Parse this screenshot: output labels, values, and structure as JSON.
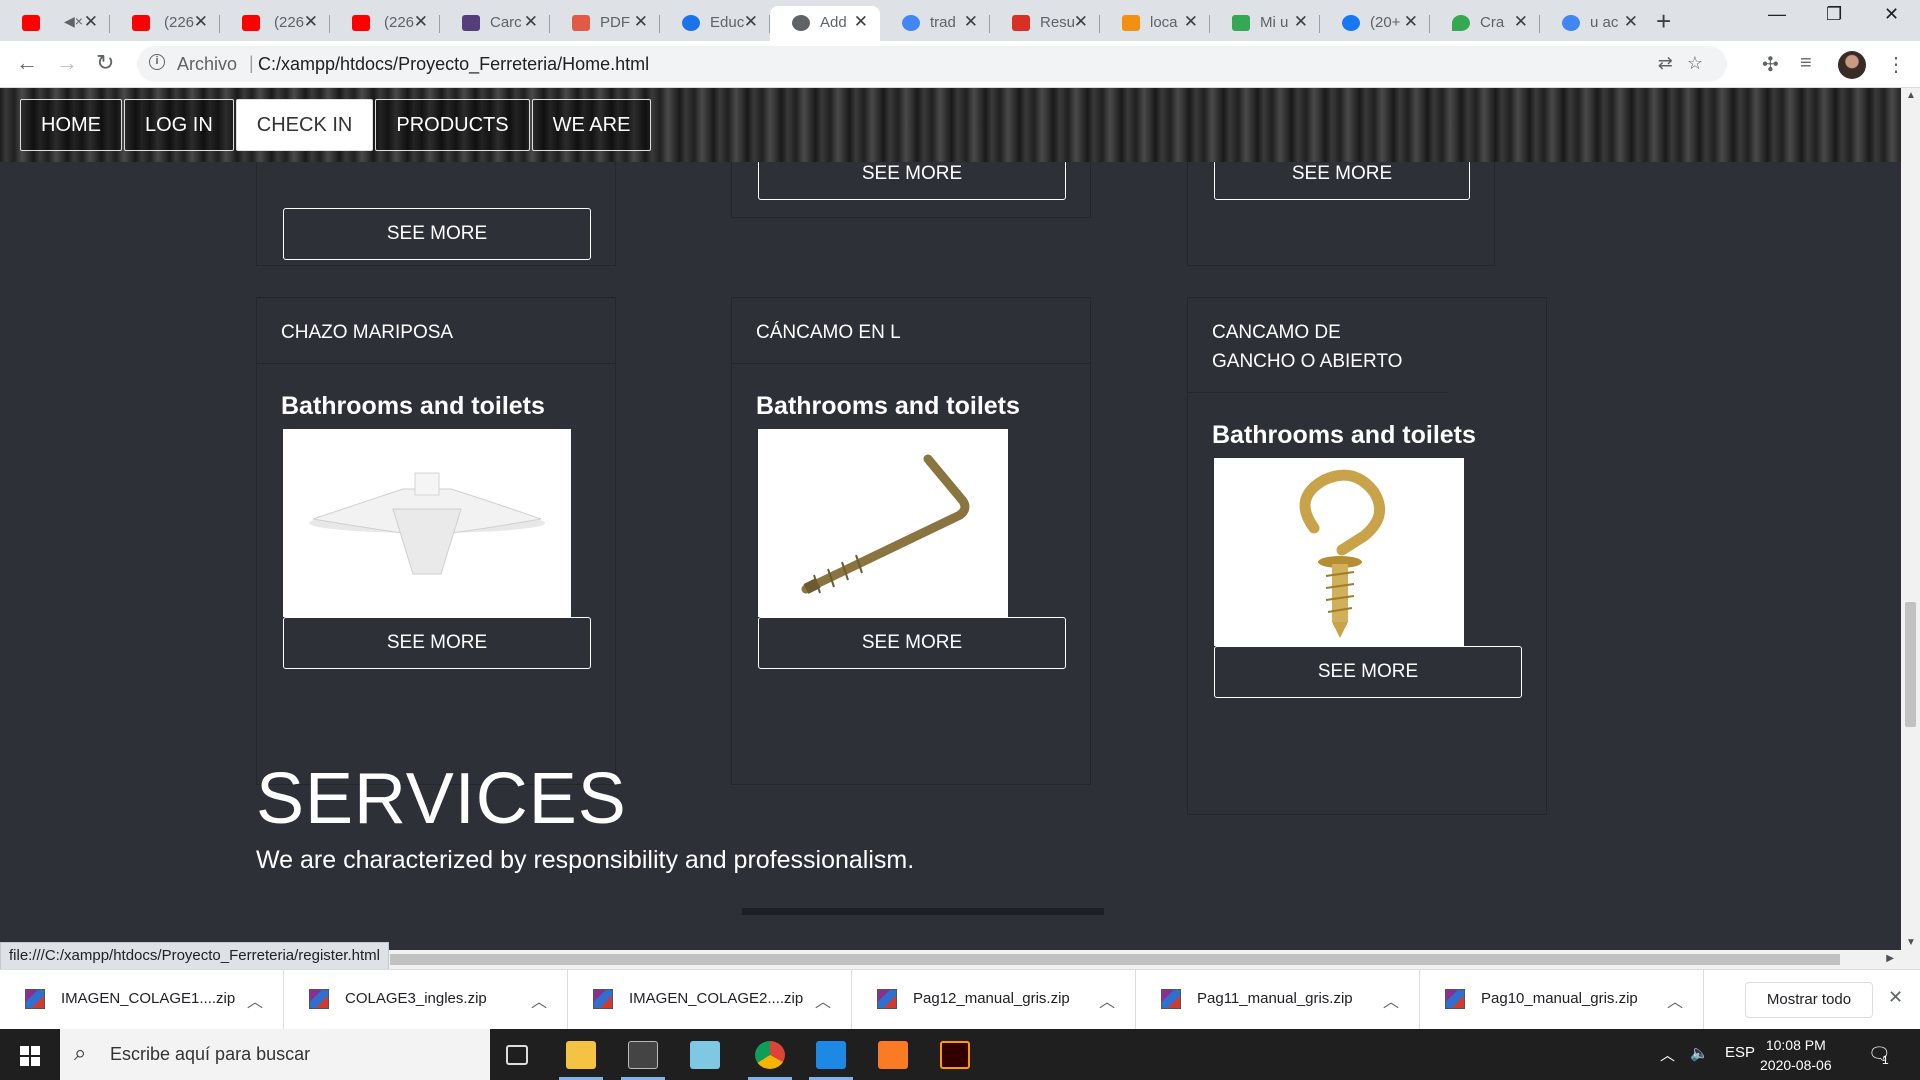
{
  "browser": {
    "tabs": [
      {
        "title": "",
        "icon": "youtube-icon",
        "color": "#ff0000"
      },
      {
        "title": "(226",
        "icon": "youtube-icon",
        "color": "#ff0000"
      },
      {
        "title": "(226",
        "icon": "youtube-icon",
        "color": "#ff0000"
      },
      {
        "title": "(226",
        "icon": "youtube-icon",
        "color": "#ff0000"
      },
      {
        "title": "Carc",
        "icon": "bootstrap-icon",
        "color": "#563d7c"
      },
      {
        "title": "PDF",
        "icon": "pdf-icon",
        "color": "#e05a47"
      },
      {
        "title": "Educ",
        "icon": "location-icon",
        "color": "#1a73e8"
      },
      {
        "title": "Add",
        "icon": "globe-icon",
        "color": "#5f6368"
      },
      {
        "title": "trad",
        "icon": "google-icon",
        "color": "#4285f4"
      },
      {
        "title": "Resu",
        "icon": "gmail-icon",
        "color": "#d93025"
      },
      {
        "title": "loca",
        "icon": "phpmyadmin-icon",
        "color": "#f29111"
      },
      {
        "title": "Mi u",
        "icon": "drive-icon",
        "color": "#34a853"
      },
      {
        "title": "(20+",
        "icon": "facebook-icon",
        "color": "#1877f2"
      },
      {
        "title": "Cra",
        "icon": "maps-icon",
        "color": "#34a853"
      },
      {
        "title": "u ac",
        "icon": "google-icon",
        "color": "#4285f4"
      }
    ],
    "address": {
      "scheme_label": "Archivo",
      "url": "C:/xampp/htdocs/Proyecto_Ferreteria/Home.html"
    }
  },
  "nav": {
    "items": [
      "HOME",
      "LOG IN",
      "CHECK IN",
      "PRODUCTS",
      "WE ARE"
    ]
  },
  "cards": {
    "see_more_label": "SEE MORE",
    "products": [
      {
        "name": "CHAZO MARIPOSA",
        "category": "Bathrooms and toilets"
      },
      {
        "name": "CÁNCAMO EN L",
        "category": "Bathrooms and toilets"
      },
      {
        "name": "CANCAMO DE GANCHO O ABIERTO",
        "category": "Bathrooms and toilets"
      }
    ]
  },
  "services": {
    "title": "SERVICES",
    "text": "We are characterized by responsibility and professionalism."
  },
  "status_url": "file:///C:/xampp/htdocs/Proyecto_Ferreteria/register.html",
  "downloads": {
    "items": [
      "IMAGEN_COLAGE1....zip",
      "COLAGE3_ingles.zip",
      "IMAGEN_COLAGE2....zip",
      "Pag12_manual_gris.zip",
      "Pag11_manual_gris.zip",
      "Pag10_manual_gris.zip"
    ],
    "show_all": "Mostrar todo"
  },
  "taskbar": {
    "search_placeholder": "Escribe aquí para buscar",
    "language": "ESP",
    "time": "10:08 PM",
    "date": "2020-08-06",
    "notification_count": "1"
  }
}
